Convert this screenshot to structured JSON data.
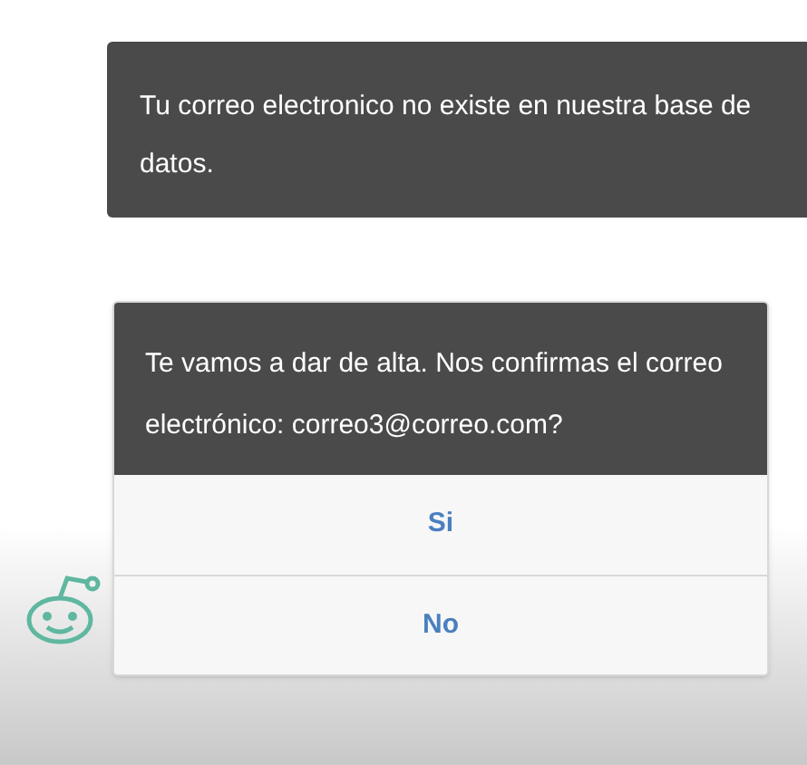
{
  "messages": [
    {
      "kind": "text",
      "text": "Tu correo electronico no existe en nuestra base de datos."
    },
    {
      "kind": "prompt",
      "text": "Te vamos a dar de alta. Nos confirmas el correo electrónico: correo3@correo.com?",
      "options": [
        "Si",
        "No"
      ]
    }
  ]
}
